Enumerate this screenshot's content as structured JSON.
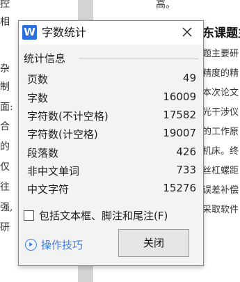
{
  "background": {
    "left_column_chars": [
      "控",
      "相",
      "杂",
      "制",
      "面:",
      "合",
      "的",
      "仅",
      "往",
      "强,",
      "研"
    ],
    "top_char": "高。",
    "right_heading": "东课题主",
    "right_lines": [
      "题主要研",
      "精度的精",
      "本次论文",
      "光干涉仪",
      "的工作原",
      "机床。终",
      "丝杠螺距",
      "误差补偿",
      "采取软件"
    ]
  },
  "dialog": {
    "title": "字数统计",
    "app_icon_letter": "W",
    "section_title": "统计信息",
    "stats": [
      {
        "label": "页数",
        "value": "49"
      },
      {
        "label": "字数",
        "value": "16009"
      },
      {
        "label": "字符数(不计空格)",
        "value": "17582"
      },
      {
        "label": "字符数(计空格)",
        "value": "19007"
      },
      {
        "label": "段落数",
        "value": "426"
      },
      {
        "label": "非中文单词",
        "value": "733"
      },
      {
        "label": "中文字符",
        "value": "15276"
      }
    ],
    "checkbox_label": "包括文本框、脚注和尾注(F)",
    "checkbox_checked": false,
    "tips_label": "操作技巧",
    "close_button_label": "关闭"
  },
  "colors": {
    "accent": "#3a7ee6",
    "app_icon": "#2a6fe0"
  }
}
